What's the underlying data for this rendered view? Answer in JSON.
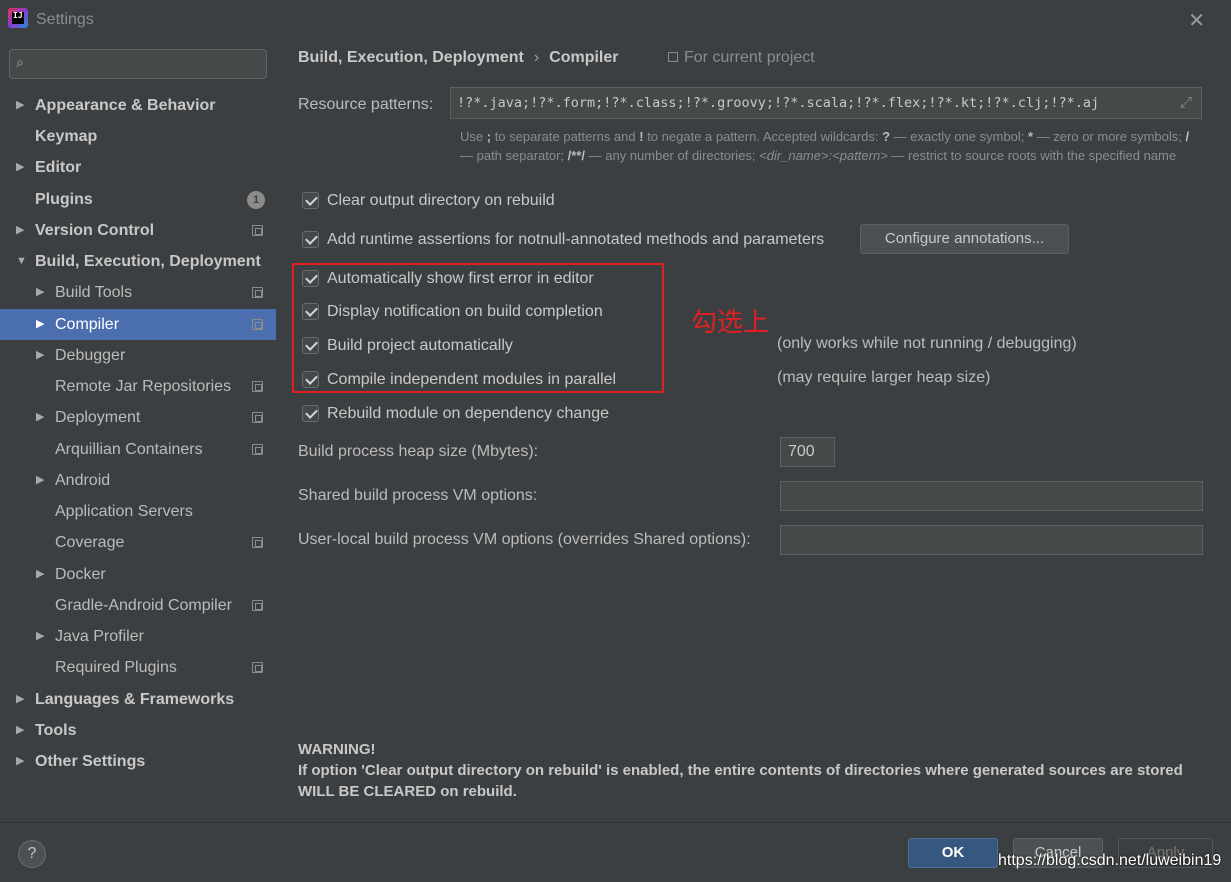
{
  "window": {
    "title": "Settings"
  },
  "search": {
    "placeholder": ""
  },
  "sidebar": {
    "items": [
      {
        "label": "Appearance & Behavior",
        "arrow": "▶"
      },
      {
        "label": "Keymap"
      },
      {
        "label": "Editor",
        "arrow": "▶"
      },
      {
        "label": "Plugins",
        "badge": "1"
      },
      {
        "label": "Version Control",
        "arrow": "▶"
      },
      {
        "label": "Build, Execution, Deployment",
        "arrow": "▼"
      },
      {
        "label": "Build Tools",
        "arrow": "▶"
      },
      {
        "label": "Compiler",
        "arrow": "▶"
      },
      {
        "label": "Debugger",
        "arrow": "▶"
      },
      {
        "label": "Remote Jar Repositories"
      },
      {
        "label": "Deployment",
        "arrow": "▶"
      },
      {
        "label": "Arquillian Containers"
      },
      {
        "label": "Android",
        "arrow": "▶"
      },
      {
        "label": "Application Servers"
      },
      {
        "label": "Coverage"
      },
      {
        "label": "Docker",
        "arrow": "▶"
      },
      {
        "label": "Gradle-Android Compiler"
      },
      {
        "label": "Java Profiler",
        "arrow": "▶"
      },
      {
        "label": "Required Plugins"
      },
      {
        "label": "Languages & Frameworks",
        "arrow": "▶"
      },
      {
        "label": "Tools",
        "arrow": "▶"
      },
      {
        "label": "Other Settings",
        "arrow": "▶"
      }
    ]
  },
  "breadcrumb": {
    "parent": "Build, Execution, Deployment",
    "sep": "›",
    "current": "Compiler",
    "scope": "For current project"
  },
  "resource": {
    "label": "Resource patterns:",
    "value": "!?*.java;!?*.form;!?*.class;!?*.groovy;!?*.scala;!?*.flex;!?*.kt;!?*.clj;!?*.aj",
    "hint_1": "Use ",
    "hint_2": ";",
    "hint_3": " to separate patterns and ",
    "hint_4": "!",
    "hint_5": " to negate a pattern. Accepted wildcards: ",
    "hint_6": "?",
    "hint_7": " — exactly one symbol; ",
    "hint_8": "*",
    "hint_9": " — zero or more symbols; ",
    "hint_10": "/",
    "hint_11": " — path separator; ",
    "hint_12": "/**/",
    "hint_13": " — any number of directories; ",
    "hint_14": "<dir_name>:<pattern>",
    "hint_15": " — restrict to source roots with the specified name"
  },
  "options": {
    "clear_output": "Clear output directory on rebuild",
    "runtime_assertions": "Add runtime assertions for notnull-annotated methods and parameters",
    "configure_button": "Configure annotations...",
    "show_first_error": "Automatically show first error in editor",
    "display_notification": "Display notification on build completion",
    "build_automatically": "Build project automatically",
    "build_automatically_note": "(only works while not running / debugging)",
    "compile_parallel": "Compile independent modules in parallel",
    "compile_parallel_note": "(may require larger heap size)",
    "rebuild_module": "Rebuild module on dependency change"
  },
  "annotation": {
    "text": "勾选上"
  },
  "heap": {
    "label": "Build process heap size (Mbytes):",
    "value": "700"
  },
  "shared_vm": {
    "label": "Shared build process VM options:",
    "value": ""
  },
  "user_vm": {
    "label": "User-local build process VM options (overrides Shared options):",
    "value": ""
  },
  "warning": {
    "title": "WARNING!",
    "body": "If option 'Clear output directory on rebuild' is enabled, the entire contents of directories where generated sources are stored WILL BE CLEARED on rebuild."
  },
  "footer": {
    "help": "?",
    "ok": "OK",
    "cancel": "Cancel",
    "apply": "Apply",
    "watermark": "https://blog.csdn.net/luweibin19"
  },
  "colors": {
    "selected": "#4b6eaf",
    "annotation": "#e02020",
    "ok_button": "#365880"
  }
}
